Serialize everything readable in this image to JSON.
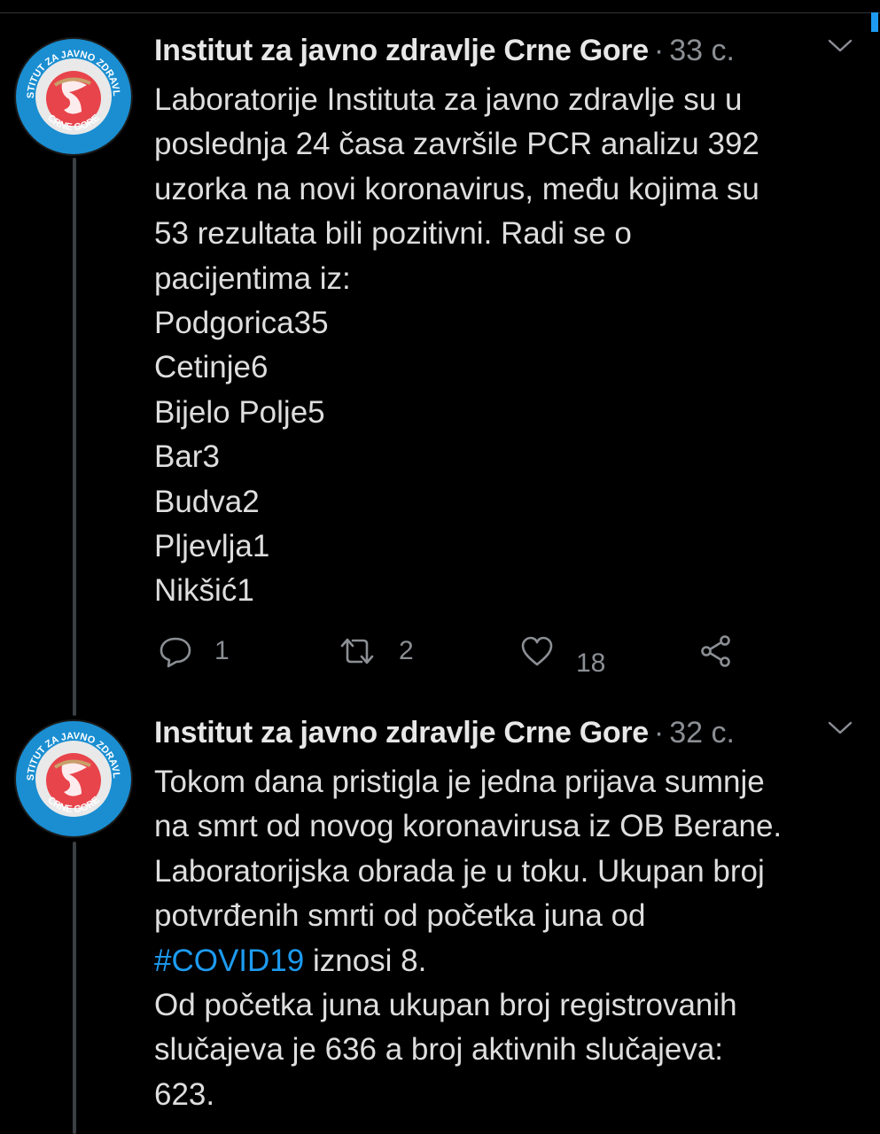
{
  "tweets": [
    {
      "author": "Institut za javno zdravlje Crne Gore",
      "separator": "·",
      "time": "33 с.",
      "text": "Laboratorije Instituta za javno zdravlje su u\nposlednja 24 časa završile PCR analizu 392\nuzorka na novi koronavirus, među kojima su\n53 rezultata bili pozitivni. Radi se o\npacijentima iz:\nPodgorica35\nCetinje6\nBijelo Polje5\nBar3\nBudva2\nPljevlja1\nNikšić1",
      "replies": "1",
      "retweets": "2",
      "likes": "18"
    },
    {
      "author": "Institut za javno zdravlje Crne Gore",
      "separator": "·",
      "time": "32 с.",
      "text_before": "Tokom dana pristigla je jedna prijava sumnje\nna smrt od novog koronavirusa iz OB Berane.\nLaboratorijska obrada je u toku. Ukupan broj\npotvrđenih smrti od početka juna od\n",
      "hashtag": "#COVID19",
      "text_after": " iznosi 8.\nOd početka juna ukupan broj registrovanih\nslučajeva je 636 a broj aktivnih slučajeva:\n623."
    }
  ],
  "avatar": {
    "logo_text_top": "INSTITUT ZA JAVNO ZDRAVLJE",
    "logo_text_bottom": "CRNE GORE"
  },
  "colors": {
    "background": "#000000",
    "accent": "#1d9bf0",
    "muted": "#8b8f94",
    "avatar_ring": "#1a8ed1",
    "avatar_emblem": "#e8444b"
  }
}
